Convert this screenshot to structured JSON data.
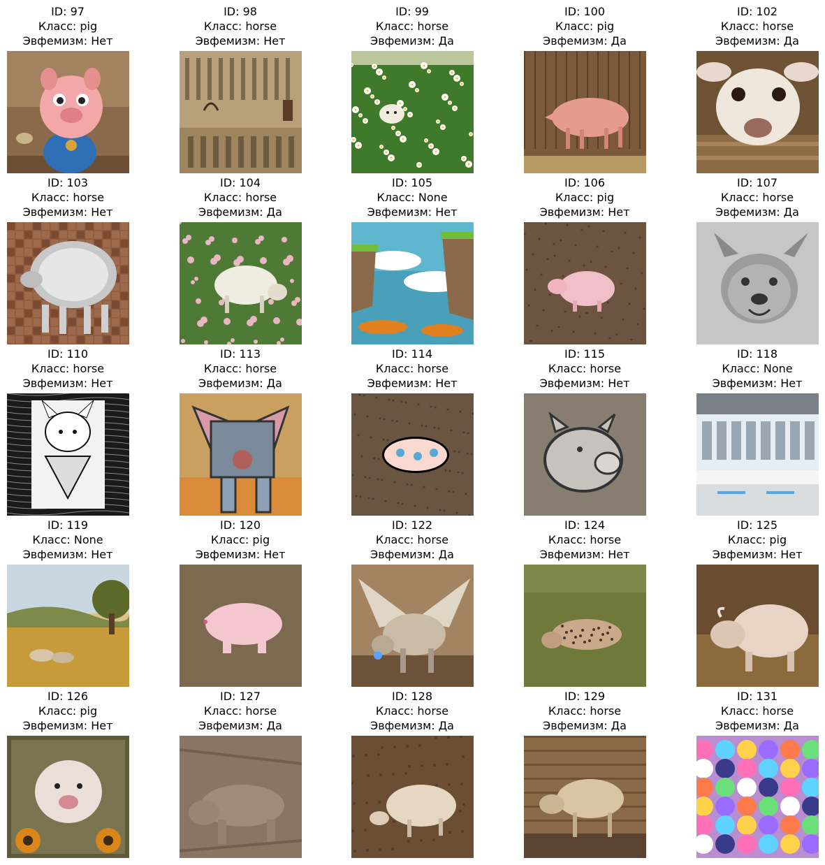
{
  "labels": {
    "id_prefix": "ID: ",
    "class_prefix": "Класс: ",
    "euph_prefix": "Эвфемизм: "
  },
  "items": [
    {
      "id": "97",
      "cls": "pig",
      "euph": "Нет",
      "scene": "cartoon-pig"
    },
    {
      "id": "98",
      "cls": "horse",
      "euph": "Нет",
      "scene": "hieroglyphs"
    },
    {
      "id": "99",
      "cls": "horse",
      "euph": "Да",
      "scene": "daisy-field"
    },
    {
      "id": "100",
      "cls": "pig",
      "euph": "Да",
      "scene": "pink-pig-barn"
    },
    {
      "id": "102",
      "cls": "horse",
      "euph": "Да",
      "scene": "lamb-face"
    },
    {
      "id": "103",
      "cls": "horse",
      "euph": "Нет",
      "scene": "mosaic-pig"
    },
    {
      "id": "104",
      "cls": "horse",
      "euph": "Да",
      "scene": "sheep-flowers"
    },
    {
      "id": "105",
      "cls": "None",
      "euph": "Нет",
      "scene": "floating-islands"
    },
    {
      "id": "106",
      "cls": "pig",
      "euph": "Нет",
      "scene": "piglet-dirt"
    },
    {
      "id": "107",
      "cls": "horse",
      "euph": "Да",
      "scene": "pencil-sketch"
    },
    {
      "id": "110",
      "cls": "horse",
      "euph": "Нет",
      "scene": "bw-engraving"
    },
    {
      "id": "113",
      "cls": "horse",
      "euph": "Да",
      "scene": "cubist-animal"
    },
    {
      "id": "114",
      "cls": "horse",
      "euph": "Нет",
      "scene": "pig-sticker"
    },
    {
      "id": "115",
      "cls": "horse",
      "euph": "Нет",
      "scene": "chalk-pig"
    },
    {
      "id": "118",
      "cls": "None",
      "euph": "Нет",
      "scene": "laboratory"
    },
    {
      "id": "119",
      "cls": "None",
      "euph": "Нет",
      "scene": "farm-landscape"
    },
    {
      "id": "120",
      "cls": "pig",
      "euph": "Нет",
      "scene": "flat-pig"
    },
    {
      "id": "122",
      "cls": "horse",
      "euph": "Да",
      "scene": "winged-beast"
    },
    {
      "id": "124",
      "cls": "horse",
      "euph": "Нет",
      "scene": "spotted-animal"
    },
    {
      "id": "125",
      "cls": "pig",
      "euph": "Нет",
      "scene": "boar-straw"
    },
    {
      "id": "126",
      "cls": "pig",
      "euph": "Нет",
      "scene": "hedgehog-pig"
    },
    {
      "id": "127",
      "cls": "horse",
      "euph": "Да",
      "scene": "stone-relief"
    },
    {
      "id": "128",
      "cls": "horse",
      "euph": "Да",
      "scene": "sheep-dirt"
    },
    {
      "id": "129",
      "cls": "horse",
      "euph": "Да",
      "scene": "furry-animal-barn"
    },
    {
      "id": "131",
      "cls": "horse",
      "euph": "Да",
      "scene": "ponies-crowd"
    }
  ]
}
